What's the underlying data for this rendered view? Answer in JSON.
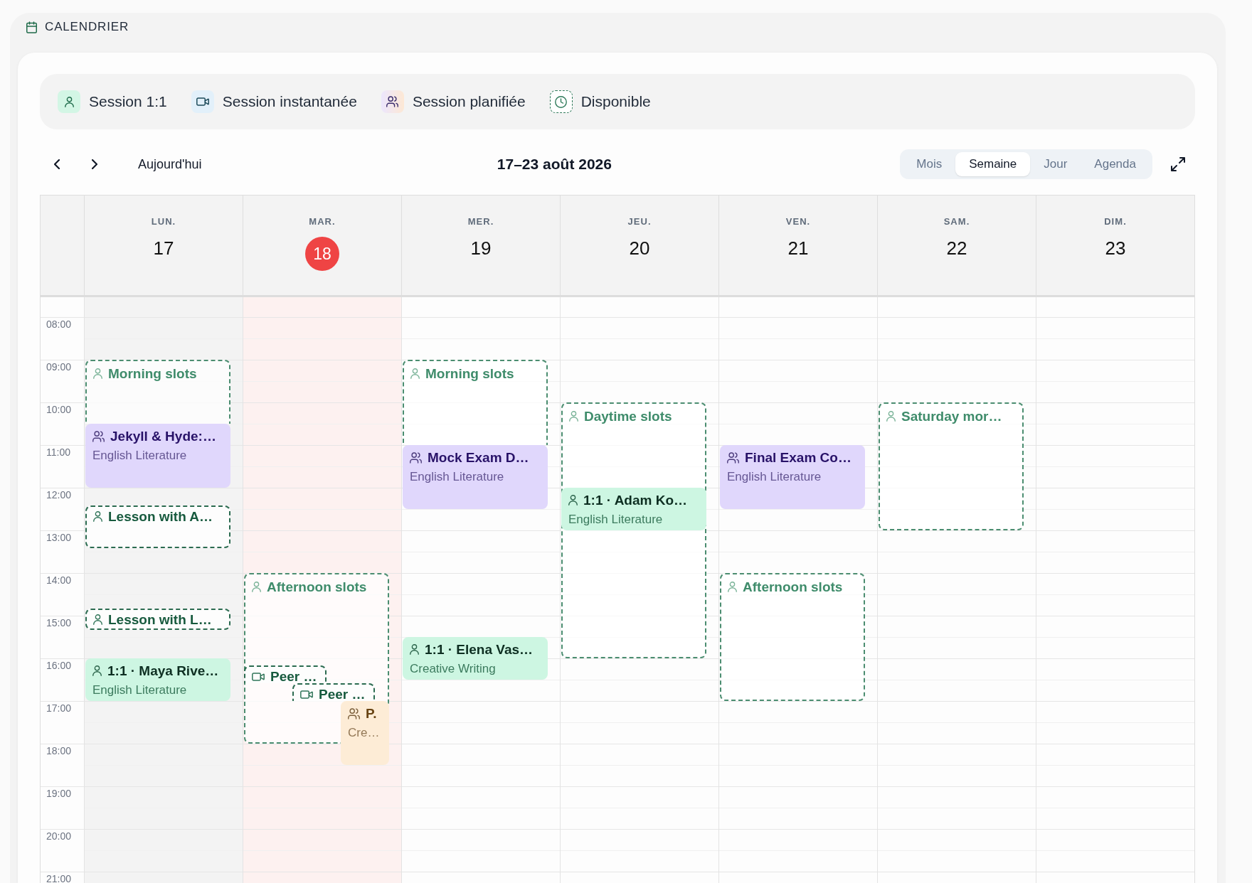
{
  "header": {
    "title": "CALENDRIER"
  },
  "legend": [
    {
      "label": "Session 1:1",
      "kind": "single"
    },
    {
      "label": "Session instantanée",
      "kind": "instant"
    },
    {
      "label": "Session planifiée",
      "kind": "planned"
    },
    {
      "label": "Disponible",
      "kind": "available"
    }
  ],
  "toolbar": {
    "today_button": "Aujourd'hui",
    "range_title": "17–23 août 2026",
    "views": [
      {
        "label": "Mois",
        "selected": false
      },
      {
        "label": "Semaine",
        "selected": true
      },
      {
        "label": "Jour",
        "selected": false
      },
      {
        "label": "Agenda",
        "selected": false
      }
    ]
  },
  "time_labels": [
    "08:00",
    "09:00",
    "10:00",
    "11:00",
    "12:00",
    "13:00",
    "14:00",
    "15:00",
    "16:00",
    "17:00",
    "18:00",
    "19:00",
    "20:00",
    "21:00"
  ],
  "days": [
    {
      "weekday": "LUN.",
      "date": "17",
      "today": false,
      "events": [
        {
          "kind": "slot",
          "title": "Morning slots"
        },
        {
          "kind": "planned",
          "title": "Jekyll & Hyde:…",
          "subtitle": "English Literature",
          "color": "#e0d7fc"
        },
        {
          "kind": "booking",
          "title": "Lesson with A…"
        },
        {
          "kind": "booking",
          "title": "Lesson with L…"
        },
        {
          "kind": "single",
          "title": "1:1 · Maya Rive…",
          "subtitle": "English Literature"
        }
      ]
    },
    {
      "weekday": "MAR.",
      "date": "18",
      "today": true,
      "events": [
        {
          "kind": "slot",
          "title": "Afternoon slots"
        },
        {
          "kind": "instant",
          "title": "Peer …"
        },
        {
          "kind": "instant",
          "title": "Peer …"
        },
        {
          "kind": "planned",
          "title": "P.",
          "subtitle": "Cre…",
          "color": "#fdecd6"
        }
      ]
    },
    {
      "weekday": "MER.",
      "date": "19",
      "today": false,
      "events": [
        {
          "kind": "slot",
          "title": "Morning slots"
        },
        {
          "kind": "planned",
          "title": "Mock Exam D…",
          "subtitle": "English Literature",
          "color": "#e0d7fc"
        },
        {
          "kind": "single",
          "title": "1:1 · Elena Vas…",
          "subtitle": "Creative Writing"
        }
      ]
    },
    {
      "weekday": "JEU.",
      "date": "20",
      "today": false,
      "events": [
        {
          "kind": "slot",
          "title": "Daytime slots"
        },
        {
          "kind": "single",
          "title": "1:1 · Adam Ko…",
          "subtitle": "English Literature"
        }
      ]
    },
    {
      "weekday": "VEN.",
      "date": "21",
      "today": false,
      "events": [
        {
          "kind": "planned",
          "title": "Final Exam Co…",
          "subtitle": "English Literature",
          "color": "#e0d7fc"
        },
        {
          "kind": "slot",
          "title": "Afternoon slots"
        }
      ]
    },
    {
      "weekday": "SAM.",
      "date": "22",
      "today": false,
      "events": [
        {
          "kind": "slot",
          "title": "Saturday mor…"
        }
      ]
    },
    {
      "weekday": "DIM.",
      "date": "23",
      "today": false
    }
  ]
}
